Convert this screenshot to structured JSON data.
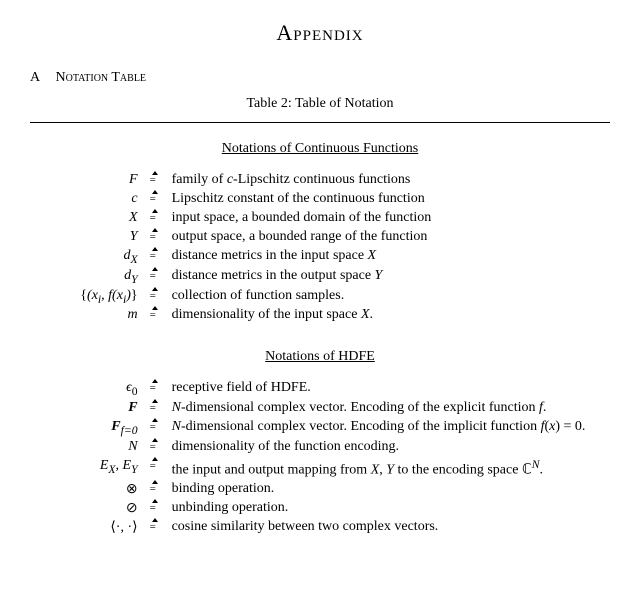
{
  "title": "Appendix",
  "section": {
    "letter": "A",
    "heading": "Notation Table"
  },
  "table_caption": "Table 2: Table of Notation",
  "groups": [
    {
      "header": "Notations of Continuous Functions",
      "rows": [
        {
          "sym": "F",
          "desc_pre": "family of ",
          "desc_it": "c",
          "desc_post": "-Lipschitz continuous functions"
        },
        {
          "sym": "c",
          "desc": "Lipschitz constant of the continuous function"
        },
        {
          "sym": "X",
          "desc": "input space, a bounded domain of the function"
        },
        {
          "sym": "Y",
          "desc": "output space, a bounded range of the function"
        },
        {
          "sym_html": "d<sub>X</sub>",
          "desc_pre": "distance metrics in the input space ",
          "desc_it": "X",
          "desc_post": ""
        },
        {
          "sym_html": "d<sub>Y</sub>",
          "desc_pre": "distance metrics in the output space ",
          "desc_it": "Y",
          "desc_post": ""
        },
        {
          "sym_html": "<span class='roman'>{</span>(x<sub>i</sub>, f(x<sub>i</sub>)<span class='roman'>}</span>",
          "desc": "collection of function samples."
        },
        {
          "sym": "m",
          "desc_pre": "dimensionality of the input space ",
          "desc_it": "X",
          "desc_post": "."
        }
      ]
    },
    {
      "header": "Notations of HDFE",
      "rows": [
        {
          "sym_html": "ϵ<sub><span class='roman'>0</span></sub>",
          "desc": "receptive field of HDFE."
        },
        {
          "sym_html": "<b>F</b>",
          "desc_html": "<i>N</i>-dimensional complex vector. Encoding of the explicit function <i>f</i>."
        },
        {
          "sym_html": "<b>F</b><sub><i>f</i>=0</sub>",
          "desc_html": "<i>N</i>-dimensional complex vector. Encoding of the implicit function <i>f</i>(<i>x</i>)&nbsp;=&nbsp;0."
        },
        {
          "sym": "N",
          "desc": "dimensionality of the function encoding."
        },
        {
          "sym_html": "E<sub>X</sub>, E<sub>Y</sub>",
          "desc_html": "the input and output mapping from <i>X</i>, <i>Y</i> to the encoding space ℂ<sup><i>N</i></sup>."
        },
        {
          "sym_html": "<span class='roman'>⊗</span>",
          "desc": "binding operation."
        },
        {
          "sym_html": "<span class='roman'>⊘</span>",
          "desc": "unbinding operation."
        },
        {
          "sym_html": "<span class='roman'>⟨·, ·⟩</span>",
          "desc": "cosine similarity between two complex vectors."
        }
      ]
    }
  ]
}
